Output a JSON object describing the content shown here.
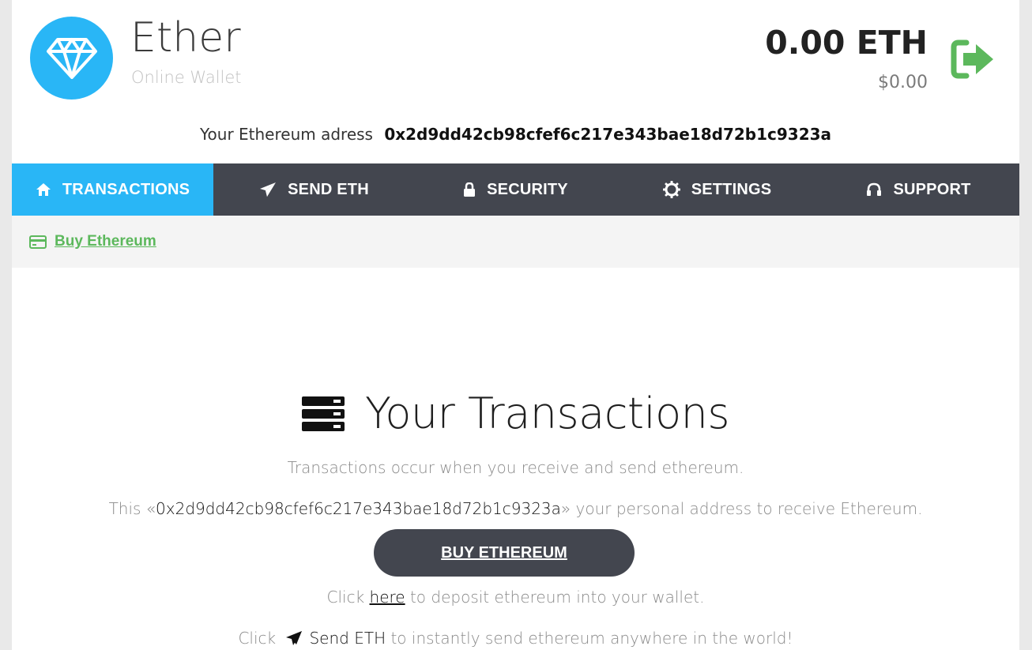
{
  "header": {
    "brand_name": "Ether",
    "brand_subtitle": "Online Wallet",
    "logo_icon": "diamond-icon",
    "balance_eth": "0.00 ETH",
    "balance_usd": "$0.00",
    "logout_icon": "sign-out-icon"
  },
  "address": {
    "label": "Your Ethereum adress",
    "value": "0x2d9dd42cb98cfef6c217e343bae18d72b1c9323a"
  },
  "nav": {
    "items": [
      {
        "label": "TRANSACTIONS",
        "icon": "home-icon",
        "active": true
      },
      {
        "label": "SEND ETH",
        "icon": "paper-plane-icon",
        "active": false
      },
      {
        "label": "SECURITY",
        "icon": "lock-icon",
        "active": false
      },
      {
        "label": "SETTINGS",
        "icon": "gear-icon",
        "active": false
      },
      {
        "label": "SUPPORT",
        "icon": "headphones-icon",
        "active": false
      }
    ]
  },
  "subbar": {
    "buy_link": "Buy Ethereum",
    "buy_icon": "credit-card-icon"
  },
  "main": {
    "title": "Your Transactions",
    "title_icon": "server-icon",
    "desc1": "Transactions occur when you receive and send ethereum.",
    "desc2_prefix": "This «",
    "desc2_address": "0x2d9dd42cb98cfef6c217e343bae18d72b1c9323a",
    "desc2_suffix": "» your personal address to receive Ethereum.",
    "buy_button": "BUY ETHEREUM",
    "desc3_prefix": "Click ",
    "desc3_link": "here",
    "desc3_suffix": " to deposit ethereum into your wallet.",
    "desc4_prefix": "Click ",
    "desc4_link": "Send ETH",
    "desc4_suffix": " to instantly send ethereum anywhere in the world!"
  },
  "colors": {
    "accent": "#29b6f6",
    "nav_bg": "#43464f",
    "success": "#5cb85c"
  }
}
